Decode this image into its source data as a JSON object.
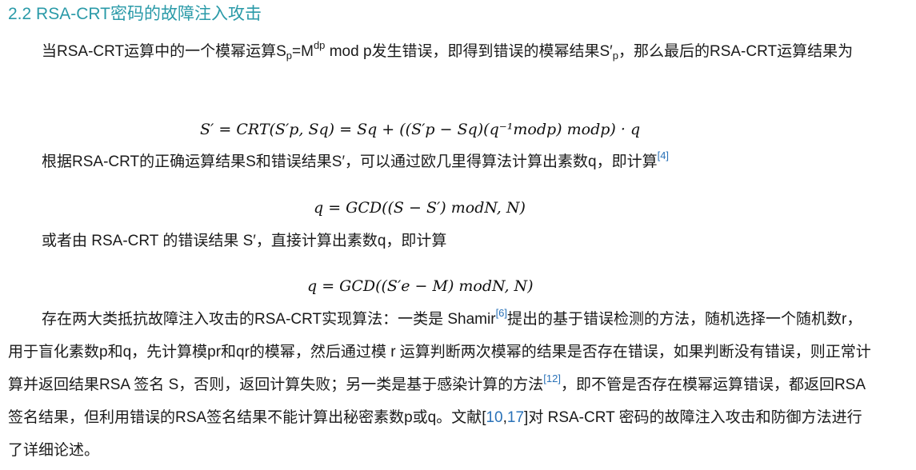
{
  "section": {
    "heading": "2.2 RSA-CRT密码的故障注入攻击"
  },
  "para1": {
    "t1": "当RSA-CRT运算中的一个模幂运算S",
    "s1": "p",
    "t2": "=M",
    "s2": "dp",
    "t3": " mod p发生错误，即得到错误的模幂结果S′",
    "s3": "p",
    "t4": "，那么最后的RSA-CRT运算结果为"
  },
  "formula1": {
    "text": "S′ =  CRT(S′p, Sq) = Sq + ((S′p − Sq)(q⁻¹modp) modp) · q"
  },
  "para2": {
    "text": "根据RSA-CRT的正确运算结果S和错误结果S′，可以通过欧几里得算法计算出素数q，即计算",
    "ref": "[4]"
  },
  "formula2": {
    "text": "q = GCD((S − S′) modN, N)"
  },
  "para3": {
    "text": "或者由 RSA-CRT 的错误结果 S′，直接计算出素数q，即计算"
  },
  "formula3": {
    "text": "q = GCD((S′e − M) modN, N)"
  },
  "para4": {
    "t1": "存在两大类抵抗故障注入攻击的RSA-CRT实现算法：一类是 Shamir",
    "ref1": "[6]",
    "t2": "提出的基于错误检测的方法，随机选择一个随机数r，用于盲化素数p和q，先计算模pr和qr的模幂，然后通过模 r 运算判断两次模幂的结果是否存在错误，如果判断没有错误，则正常计算并返回结果RSA 签名 S，否则，返回计算失败；另一类是基于感染计算的方法",
    "ref2": "[12]",
    "t3": "，即不管是否存在模幂运算错误，都返回RSA签名结果，但利用错误的RSA签名结果不能计算出秘密素数p或q。文献[",
    "ref3a": "10",
    "t4": ",",
    "ref3b": "17",
    "t5": "]对 RSA-CRT 密码的故障注入攻击和防御方法进行了详细论述。"
  },
  "colors": {
    "heading": "#2a9aa8",
    "reference": "#2a72b8",
    "text": "#1a1a1a"
  }
}
